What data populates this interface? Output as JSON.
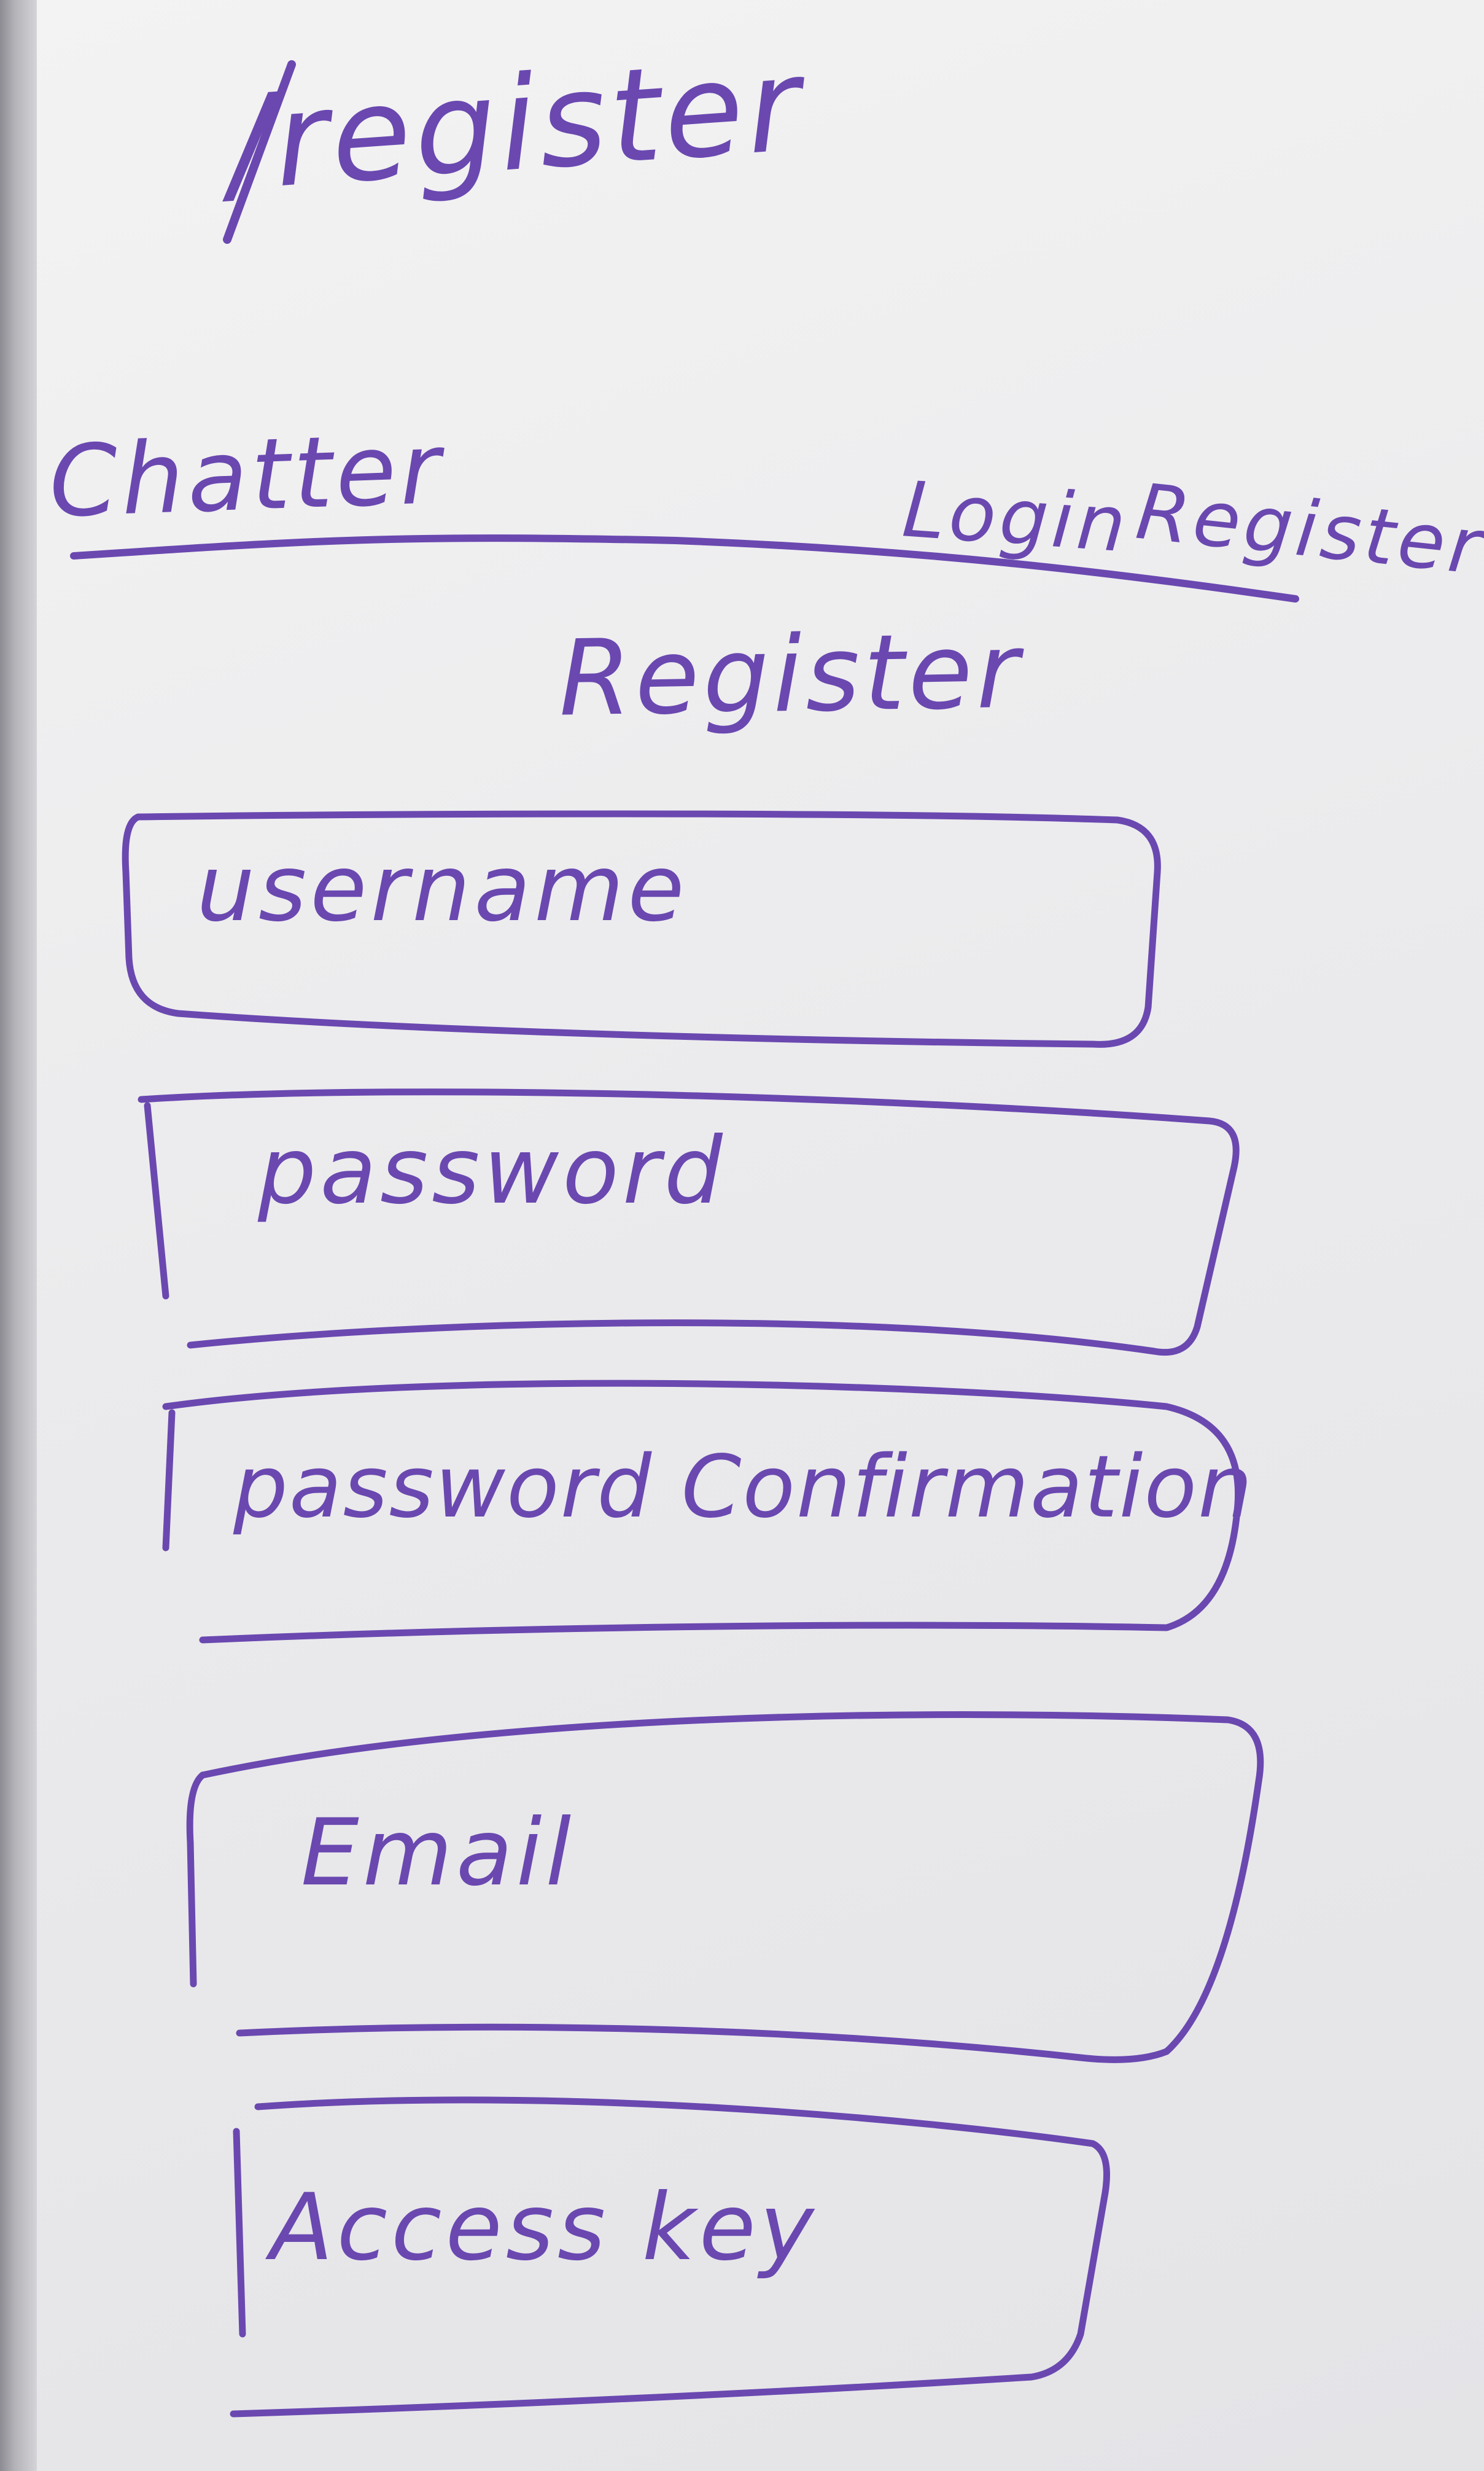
{
  "route": "/register",
  "header": {
    "app_title": "Chatter",
    "nav": {
      "login_label": "Login",
      "register_label": "Register"
    }
  },
  "main": {
    "heading": "Register",
    "fields": [
      {
        "placeholder": "username"
      },
      {
        "placeholder": "password"
      },
      {
        "placeholder": "password Confirmation"
      },
      {
        "placeholder": "Email"
      },
      {
        "placeholder": "Access key"
      }
    ]
  },
  "colors": {
    "ink": "#6a48b0",
    "board": "#ebebed"
  }
}
